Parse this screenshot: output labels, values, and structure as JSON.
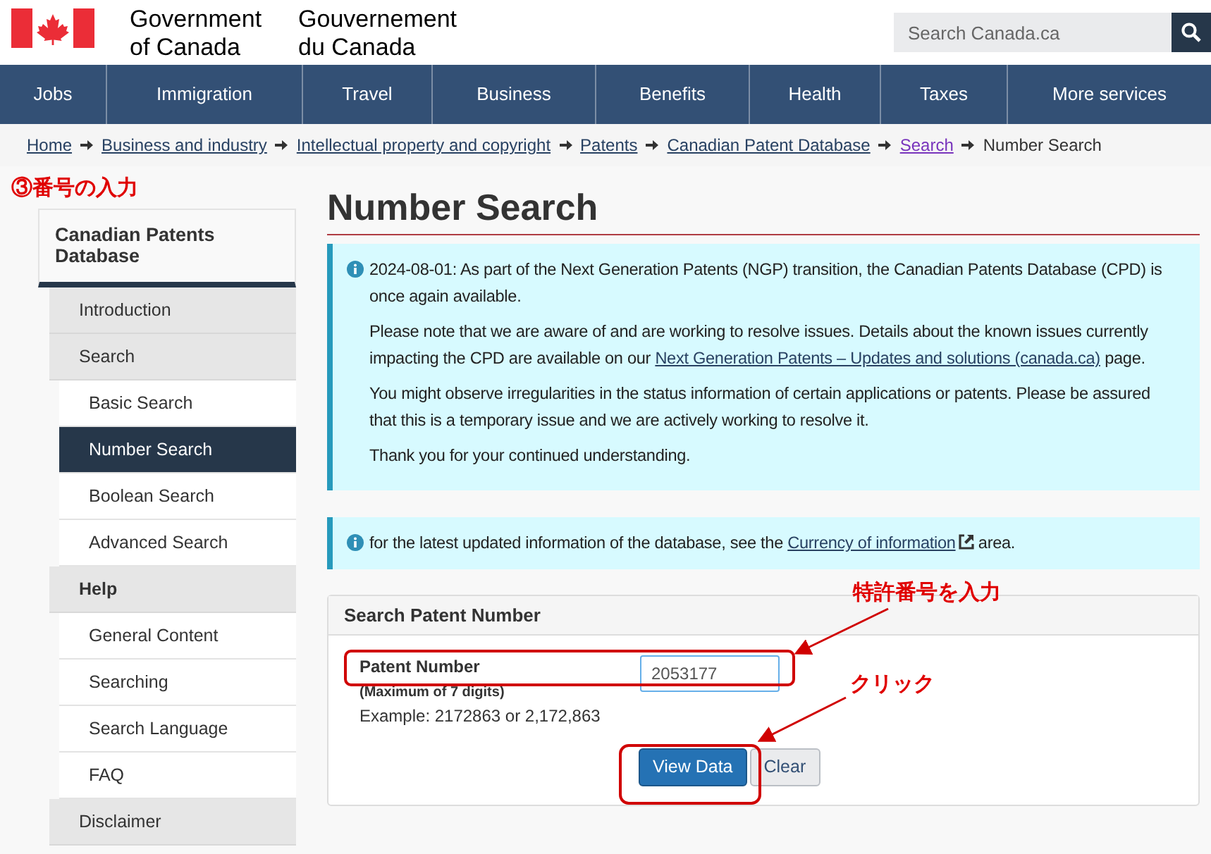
{
  "header": {
    "name_en": [
      "Government",
      "of Canada"
    ],
    "name_fr": [
      "Gouvernement",
      "du Canada"
    ],
    "search": {
      "placeholder": "Search Canada.ca"
    }
  },
  "nav": [
    "Jobs",
    "Immigration",
    "Travel",
    "Business",
    "Benefits",
    "Health",
    "Taxes",
    "More services"
  ],
  "breadcrumb": [
    {
      "label": "Home",
      "kind": "link"
    },
    {
      "label": "Business and industry",
      "kind": "link"
    },
    {
      "label": "Intellectual property and copyright",
      "kind": "link"
    },
    {
      "label": "Patents",
      "kind": "link"
    },
    {
      "label": "Canadian Patent Database",
      "kind": "link"
    },
    {
      "label": "Search",
      "kind": "visited"
    },
    {
      "label": "Number Search",
      "kind": "current"
    }
  ],
  "annotations": {
    "step_title": "③番号の入力",
    "callouts": [
      "特許番号を入力",
      "クリック"
    ]
  },
  "sidebar": {
    "title": "Canadian Patents Database",
    "items": [
      {
        "label": "Introduction",
        "bold": false,
        "selected": false
      },
      {
        "label": "Search",
        "bold": false,
        "selected": false,
        "children": [
          {
            "label": "Basic Search",
            "selected": false
          },
          {
            "label": "Number Search",
            "selected": true
          },
          {
            "label": "Boolean Search",
            "selected": false
          },
          {
            "label": "Advanced Search",
            "selected": false
          }
        ]
      },
      {
        "label": "Help",
        "bold": true,
        "selected": false,
        "children": [
          {
            "label": "General Content",
            "selected": false
          },
          {
            "label": "Searching",
            "selected": false
          },
          {
            "label": "Search Language",
            "selected": false
          },
          {
            "label": "FAQ",
            "selected": false
          }
        ]
      },
      {
        "label": "Disclaimer",
        "bold": false,
        "selected": false
      }
    ]
  },
  "page_title": "Number Search",
  "notices": [
    {
      "paragraphs": [
        {
          "text": "2024-08-01:  As part of the Next Generation Patents (NGP) transition, the Canadian Patents Database (CPD) is once again available."
        },
        {
          "text": "Please note that we are aware of and are working to resolve issues. Details about the known issues currently impacting the CPD are available on our",
          "link": "Next Generation Patents – Updates and solutions (canada.ca)",
          "after": "page."
        },
        {
          "text": "You might observe irregularities in the status information of certain applications or patents. Please be assured that this is a temporary issue and we are actively working to resolve it."
        },
        {
          "text": "Thank you for your continued understanding."
        }
      ]
    },
    {
      "paragraphs": [
        {
          "text": "for the latest updated information of the database, see the",
          "link": "Currency of information",
          "external": true,
          "after": "area."
        }
      ]
    }
  ],
  "form": {
    "title": "Search Patent Number",
    "label": "Patent Number",
    "hint": "(Maximum of 7 digits)",
    "value": "2053177",
    "example": "Example: 2172863 or 2,172,863",
    "buttons": [
      {
        "label": "View Data",
        "kind": "primary"
      },
      {
        "label": "Clear",
        "kind": "default"
      }
    ]
  }
}
